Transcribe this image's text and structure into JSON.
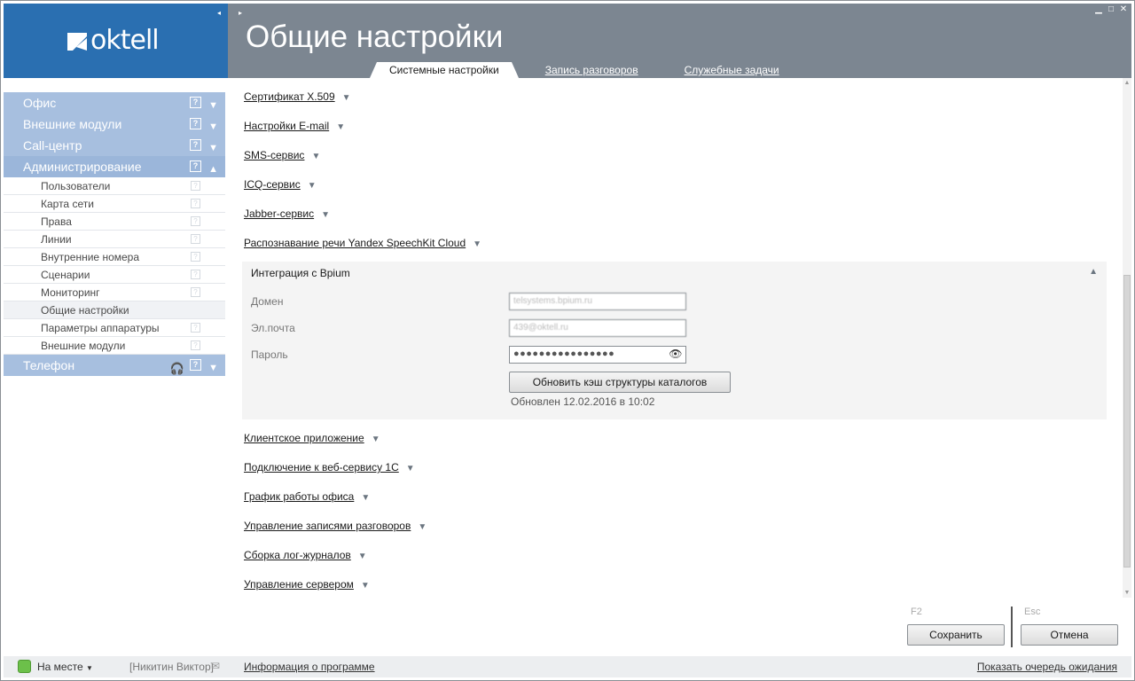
{
  "app": {
    "logo_text": "oktell",
    "collapse_glyph": "◂",
    "expand_glyph": "▸"
  },
  "header": {
    "title": "Общие настройки",
    "tabs": [
      {
        "label": "Системные настройки",
        "active": true
      },
      {
        "label": "Запись разговоров",
        "active": false
      },
      {
        "label": "Служебные задачи",
        "active": false
      }
    ]
  },
  "sidebar": {
    "groups": [
      {
        "label": "Офис"
      },
      {
        "label": "Внешние модули"
      },
      {
        "label": "Call-центр"
      },
      {
        "label": "Администрирование"
      },
      {
        "label": "Телефон"
      }
    ],
    "admin_items": [
      {
        "label": "Пользователи"
      },
      {
        "label": "Карта сети"
      },
      {
        "label": "Права"
      },
      {
        "label": "Линии"
      },
      {
        "label": "Внутренние номера"
      },
      {
        "label": "Сценарии"
      },
      {
        "label": "Мониторинг"
      },
      {
        "label": "Общие настройки",
        "active": true
      },
      {
        "label": "Параметры аппаратуры"
      },
      {
        "label": "Внешние модули"
      }
    ],
    "help_glyph": "?"
  },
  "sections_top": [
    {
      "label": "Сертификат X.509"
    },
    {
      "label": "Настройки E-mail"
    },
    {
      "label": "SMS-сервис"
    },
    {
      "label": "ICQ-сервис"
    },
    {
      "label": "Jabber-сервис"
    },
    {
      "label": "Распознавание речи Yandex SpeechKit Cloud"
    }
  ],
  "expanded_section": {
    "title": "Интеграция с Bpium",
    "fields": {
      "domain_label": "Домен",
      "domain_value": "telsystems.bpium.ru",
      "email_label": "Эл.почта",
      "email_value": "439@oktell.ru",
      "password_label": "Пароль",
      "password_mask": "●●●●●●●●●●●●●●●●"
    },
    "refresh_button": "Обновить кэш структуры каталогов",
    "updated_text": "Обновлен 12.02.2016 в 10:02"
  },
  "sections_bottom": [
    {
      "label": "Клиентское приложение"
    },
    {
      "label": "Подключение к веб-сервису 1С"
    },
    {
      "label": "График работы офиса"
    },
    {
      "label": "Управление записями разговоров"
    },
    {
      "label": "Сборка лог-журналов"
    },
    {
      "label": "Управление сервером"
    }
  ],
  "actions": {
    "save_hint": "F2",
    "save_label": "Сохранить",
    "cancel_hint": "Esc",
    "cancel_label": "Отмена"
  },
  "statusbar": {
    "status": "На месте",
    "user": "[Никитин Виктор]",
    "about": "Информация о программе",
    "queue": "Показать очередь ожидания"
  },
  "colors": {
    "logo_bg": "#2a6fb1",
    "header_bg": "#7c8691",
    "sidebar_group": "#a7bfdf",
    "status_online": "#6cc04a"
  }
}
